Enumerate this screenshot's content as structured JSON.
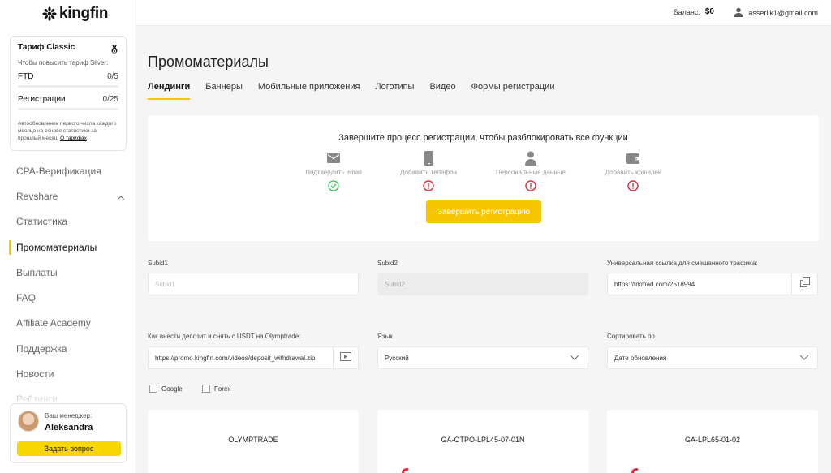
{
  "brand": {
    "name": "kingfin",
    "accent": "#f7c600"
  },
  "sidebar": {
    "tariff": {
      "title": "Тариф Classic",
      "subtitle": "Чтобы повысить тариф Silver:",
      "metrics": [
        {
          "label": "FTD",
          "value": "0/5",
          "progress": 0
        },
        {
          "label": "Регистрации",
          "value": "0/25",
          "progress": 0
        }
      ],
      "note": "Автообновление первого числа каждого месяца на основе статистики за прошлый месяц.",
      "link": "О тарифах"
    },
    "nav": [
      {
        "label": "CPA-Верификация"
      },
      {
        "label": "Revshare"
      },
      {
        "label": "Статистика"
      },
      {
        "label": "Промоматериалы"
      },
      {
        "label": "Выплаты"
      },
      {
        "label": "FAQ"
      },
      {
        "label": "Affiliate Academy"
      },
      {
        "label": "Поддержка"
      },
      {
        "label": "Новости"
      },
      {
        "label": "Рейтинги"
      }
    ],
    "manager": {
      "label": "Ваш менеджер:",
      "name": "Aleksandra",
      "button": "Задать вопрос"
    }
  },
  "topbar": {
    "balance_label": "Баланс:",
    "balance_value": "$0",
    "user_email": "asserlik1@gmail.com"
  },
  "main": {
    "title": "Промоматериалы",
    "tabs": [
      {
        "label": "Лендинги"
      },
      {
        "label": "Баннеры"
      },
      {
        "label": "Мобильные приложения"
      },
      {
        "label": "Логотипы"
      },
      {
        "label": "Видео"
      },
      {
        "label": "Формы регистрации"
      }
    ],
    "registration": {
      "title": "Завершите процесс регистрации, чтобы разблокировать все функции",
      "steps": [
        {
          "label": "Подтвердить email",
          "icon": "envelope-icon",
          "status": "done"
        },
        {
          "label": "Добавить телефон",
          "icon": "phone-icon",
          "status": "warning"
        },
        {
          "label": "Персональные данные",
          "icon": "user-icon",
          "status": "warning"
        },
        {
          "label": "Добавить кошелек",
          "icon": "wallet-icon",
          "status": "warning"
        }
      ],
      "button": "Завершить регистрацию"
    },
    "filters": {
      "subid1": {
        "label": "Subid1",
        "placeholder": "Subid1",
        "value": ""
      },
      "subid2": {
        "label": "Subid2",
        "placeholder": "Subid2",
        "value": ""
      },
      "universal_link": {
        "label": "Универсальная ссылка для смешанного трафика:",
        "value": "https://trkmad.com/2518994"
      },
      "deposit_video": {
        "label": "Как внести депозит и снять с USDT на Olymptrade:",
        "value": "https://promo.kingfin.com/videos/deposit_withdrawal.zip"
      },
      "language": {
        "label": "Язык",
        "value": "Русский"
      },
      "sort": {
        "label": "Сортировать по",
        "value": "Дате обновления"
      },
      "checkboxes": [
        {
          "label": "Google",
          "checked": false
        },
        {
          "label": "Forex",
          "checked": false
        }
      ]
    },
    "cards": [
      {
        "title": "OLYMPTRADE"
      },
      {
        "title": "GA-OTPO-LPL45-07-01N"
      },
      {
        "title": "GA-LPL65-01-02"
      }
    ]
  }
}
